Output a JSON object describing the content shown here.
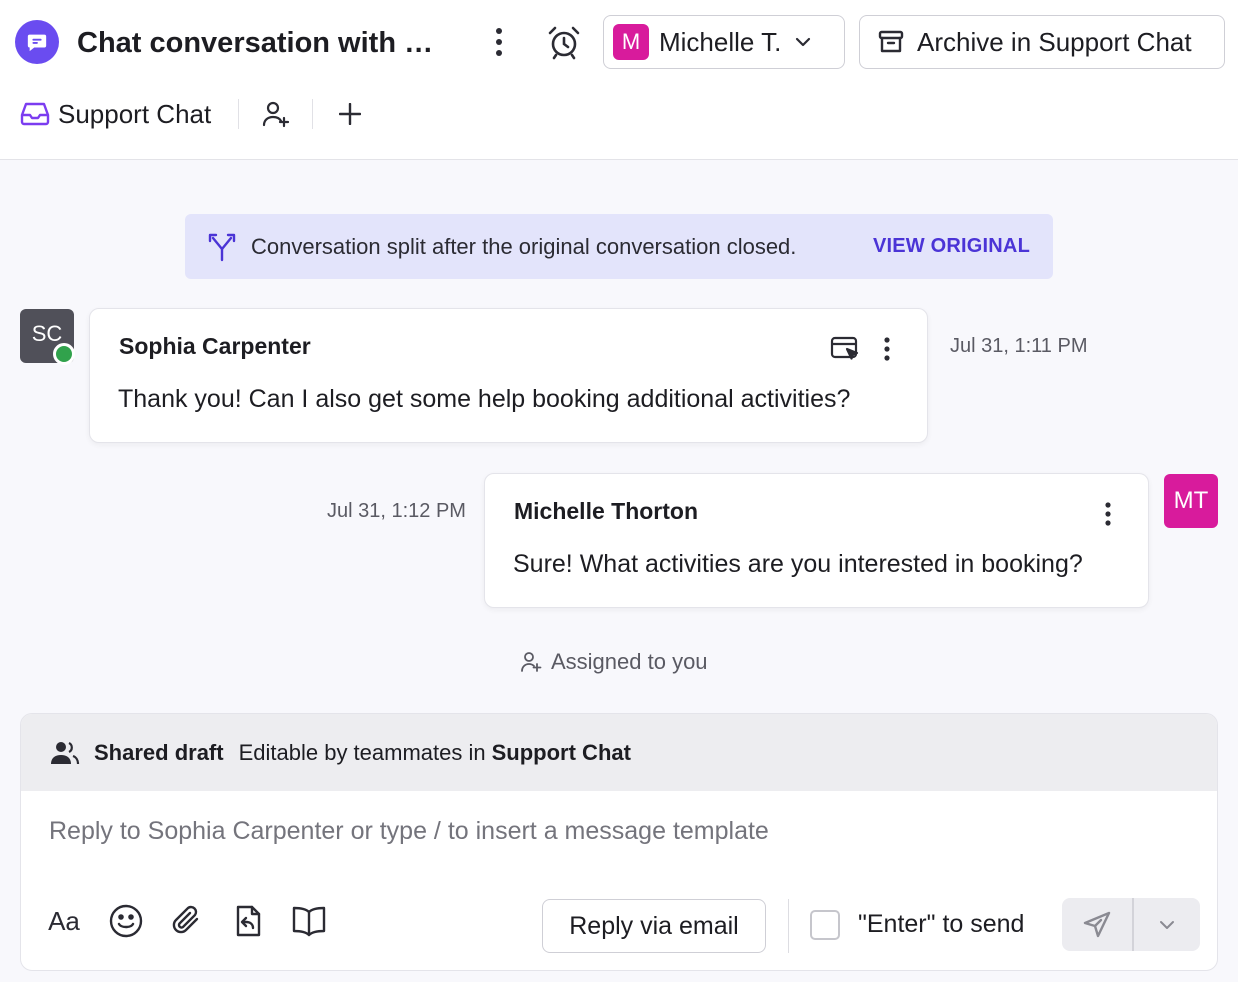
{
  "header": {
    "title": "Chat conversation with Sophia Carpenter",
    "assignee": {
      "initial": "M",
      "name": "Michelle T.",
      "color": "#d81b9c"
    },
    "archive_label": "Archive in Support Chat",
    "inbox_label": "Support Chat"
  },
  "banner": {
    "text": "Conversation split after the original conversation closed.",
    "link_label": "VIEW ORIGINAL"
  },
  "messages": [
    {
      "avatar_initials": "SC",
      "sender": "Sophia Carpenter",
      "text": "Thank you! Can I also get some help booking additional activities?",
      "time": "Jul 31, 1:11 PM",
      "status": "online"
    },
    {
      "avatar_initials": "MT",
      "sender": "Michelle Thorton",
      "text": "Sure! What activities are you interested in booking?",
      "time": "Jul 31, 1:12 PM"
    }
  ],
  "event_note": "Assigned to you",
  "composer": {
    "draft_title": "Shared draft",
    "draft_subtitle": "Editable by teammates in",
    "draft_inbox": "Support Chat",
    "placeholder": "Reply to Sophia Carpenter or type / to insert a message template",
    "format_label": "Aa",
    "reply_email_label": "Reply via email",
    "enter_to_send_label": "\"Enter\" to send",
    "enter_to_send_checked": false
  },
  "colors": {
    "accent": "#6a4cf0",
    "link": "#4b34d6",
    "banner_bg": "#e3e4fb",
    "agent_avatar": "#d81b9c",
    "online": "#31a24c"
  }
}
